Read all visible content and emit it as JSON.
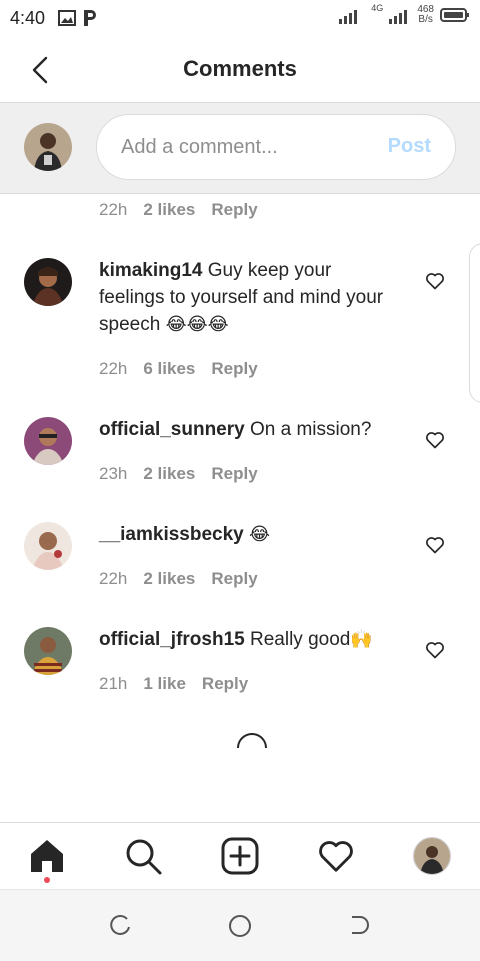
{
  "status_bar": {
    "time": "4:40",
    "network_type": "4G",
    "speed_value": "468",
    "speed_unit": "B/s"
  },
  "header": {
    "title": "Comments"
  },
  "composer": {
    "placeholder": "Add a comment...",
    "post_label": "Post"
  },
  "previous_meta": {
    "time": "22h",
    "likes": "2 likes",
    "reply": "Reply"
  },
  "comments": [
    {
      "username": "kimaking14",
      "text": "Guy keep your feelings to yourself and mind your speech",
      "emoji": "😂😂😂",
      "time": "22h",
      "likes": "6 likes",
      "reply": "Reply"
    },
    {
      "username": "official_sunnery",
      "text": "On a mission?",
      "emoji": "",
      "time": "23h",
      "likes": "2 likes",
      "reply": "Reply"
    },
    {
      "username": "__iamkissbecky",
      "text": "",
      "emoji": "😂",
      "time": "22h",
      "likes": "2 likes",
      "reply": "Reply"
    },
    {
      "username": "official_jfrosh15",
      "text": "Really good",
      "emoji": "🙌",
      "time": "21h",
      "likes": "1 like",
      "reply": "Reply"
    }
  ],
  "bottom_nav": {
    "items": [
      "home-icon",
      "search-icon",
      "new-post-icon",
      "activity-heart-icon",
      "profile-avatar"
    ]
  },
  "system_nav": {
    "items": [
      "recents-icon",
      "home-circle-icon",
      "back-icon"
    ]
  },
  "colors": {
    "accent_post": "#b3dbff",
    "notification_dot": "#ed4956",
    "secondary_text": "#8e8e8e"
  }
}
